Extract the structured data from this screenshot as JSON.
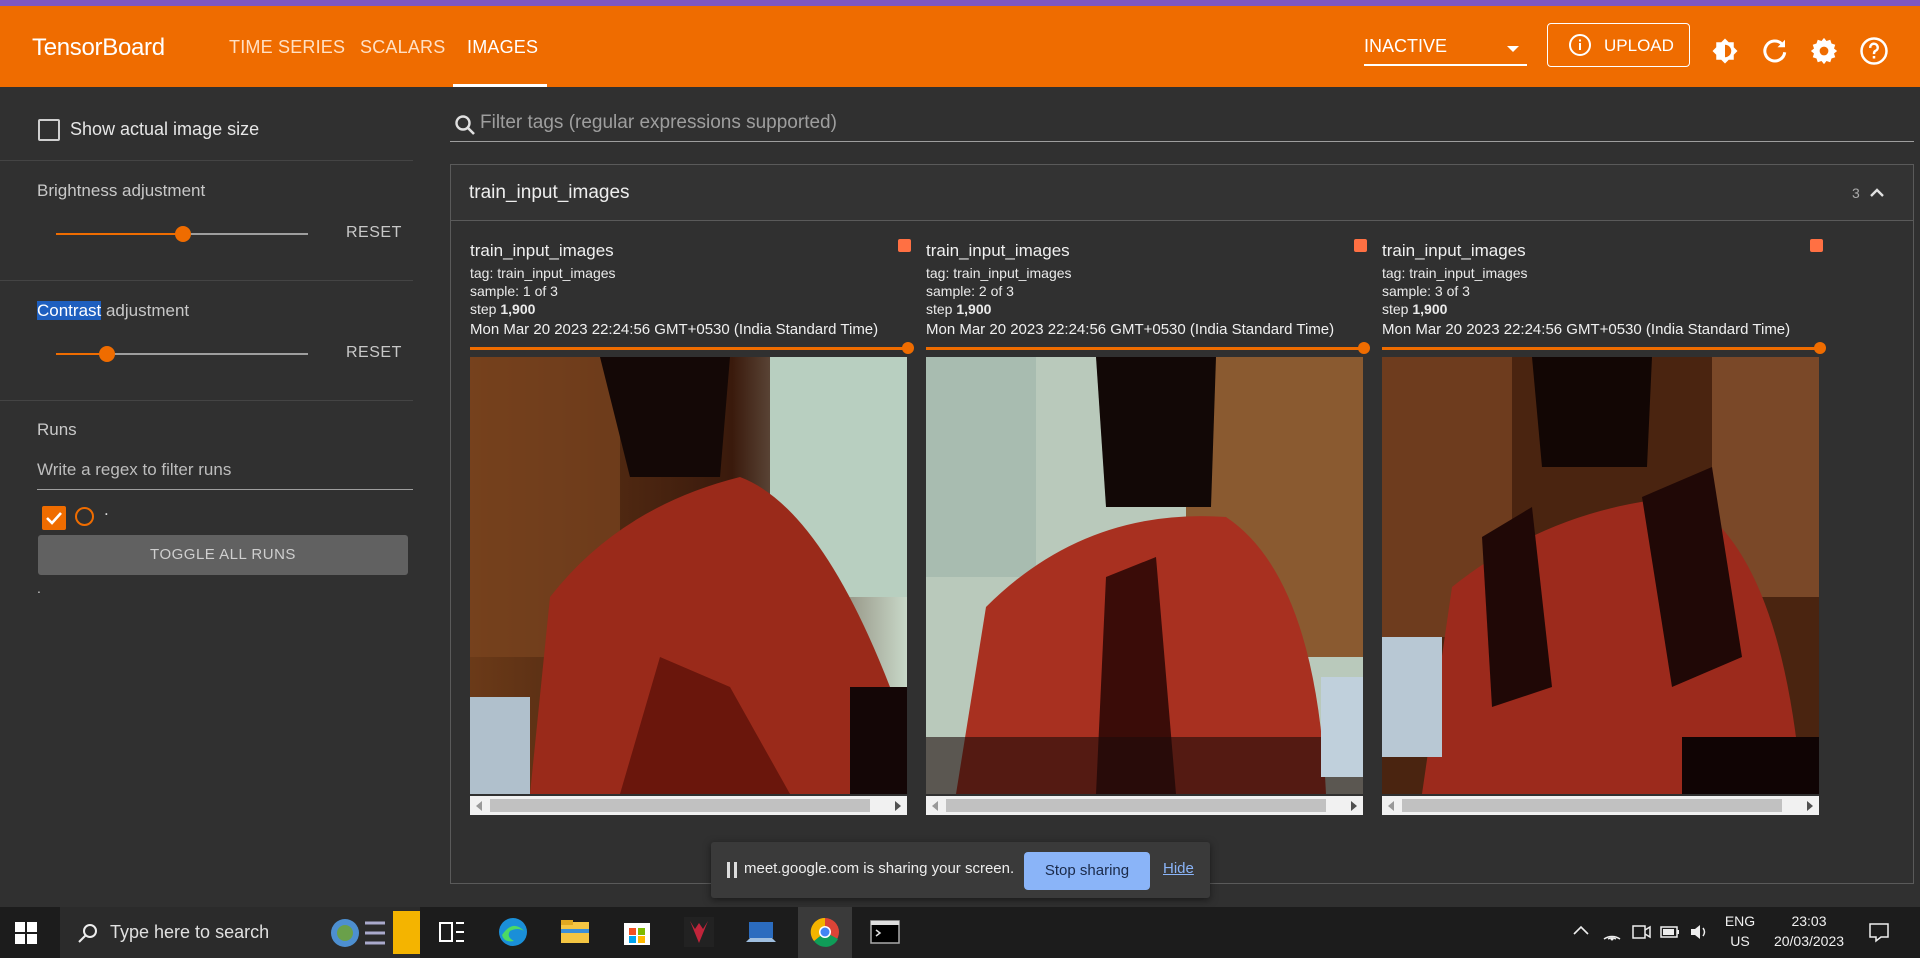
{
  "topbar": {
    "brand": "TensorBoard",
    "tabs": [
      {
        "label": "TIME SERIES"
      },
      {
        "label": "SCALARS"
      },
      {
        "label": "IMAGES"
      }
    ],
    "run_select": "INACTIVE",
    "upload_label": "UPLOAD",
    "colors": {
      "accent": "#ef6c00",
      "top_strip": "#7e57c2"
    }
  },
  "sidebar": {
    "show_actual_size": "Show actual image size",
    "brightness_label": "Brightness adjustment",
    "brightness_value": 0.5,
    "contrast_word": "Contrast",
    "contrast_rest": " adjustment",
    "contrast_value": 0.2,
    "reset_label": "RESET",
    "runs_title": "Runs",
    "runs_filter_placeholder": "Write a regex to filter runs",
    "run_name": ".",
    "toggle_all": "TOGGLE ALL RUNS",
    "footer_dot": "."
  },
  "main": {
    "filter_placeholder": "Filter tags (regular expressions supported)",
    "group_title": "train_input_images",
    "group_count": "3",
    "cards": [
      {
        "title": "train_input_images",
        "tag": "tag: train_input_images",
        "sample": "sample: 1 of 3",
        "step_prefix": "step ",
        "step": "1,900",
        "timestamp": "Mon Mar 20 2023 22:24:56 GMT+0530 (India Standard Time)"
      },
      {
        "title": "train_input_images",
        "tag": "tag: train_input_images",
        "sample": "sample: 2 of 3",
        "step_prefix": "step ",
        "step": "1,900",
        "timestamp": "Mon Mar 20 2023 22:24:56 GMT+0530 (India Standard Time)"
      },
      {
        "title": "train_input_images",
        "tag": "tag: train_input_images",
        "sample": "sample: 3 of 3",
        "step_prefix": "step ",
        "step": "1,900",
        "timestamp": "Mon Mar 20 2023 22:24:56 GMT+0530 (India Standard Time)"
      }
    ]
  },
  "share_banner": {
    "message": "meet.google.com is sharing your screen.",
    "stop_label": "Stop sharing",
    "hide_label": "Hide"
  },
  "taskbar": {
    "search_placeholder": "Type here to search",
    "lang_top": "ENG",
    "lang_bottom": "US",
    "time": "23:03",
    "date": "20/03/2023"
  }
}
